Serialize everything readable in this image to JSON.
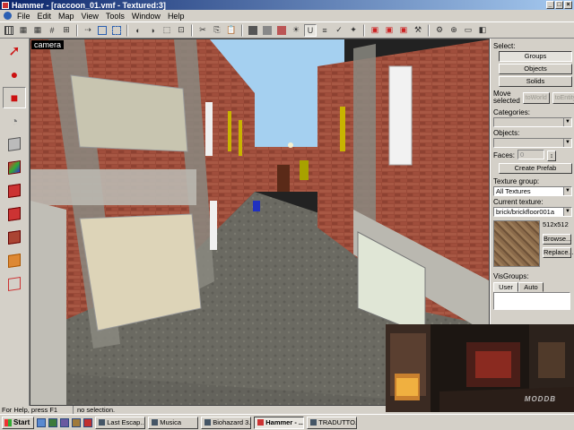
{
  "window": {
    "title": "Hammer - [raccoon_01.vmf - Textured:3]"
  },
  "menu": [
    "File",
    "Edit",
    "Map",
    "View",
    "Tools",
    "Window",
    "Help"
  ],
  "viewport": {
    "label": "camera"
  },
  "right_panel": {
    "select_label": "Select:",
    "groups": "Groups",
    "objects_btn": "Objects",
    "solids": "Solids",
    "move_selected": "Move selected",
    "to_world": "toWorld",
    "to_entity": "toEntity",
    "categories_label": "Categories:",
    "objects_label": "Objects:",
    "faces_label": "Faces:",
    "faces_value": "0",
    "create_prefab": "Create Prefab",
    "texture_group_label": "Texture group:",
    "texture_group_value": "All Textures",
    "current_texture_label": "Current texture:",
    "current_texture_value": "brick/brickfloor001a",
    "texture_size": "512x512",
    "browse": "Browse...",
    "replace": "Replace...",
    "visgroups_label": "VisGroups:",
    "tab_user": "User",
    "tab_auto": "Auto"
  },
  "status": {
    "help": "For Help, press F1",
    "selection": "no selection."
  },
  "taskbar": {
    "start": "Start",
    "tasks": [
      "Last Escap...",
      "Musica",
      "Biohazard 3...",
      "Hammer - ...",
      "TRADUTTO..."
    ]
  },
  "watermark": "MODDB"
}
